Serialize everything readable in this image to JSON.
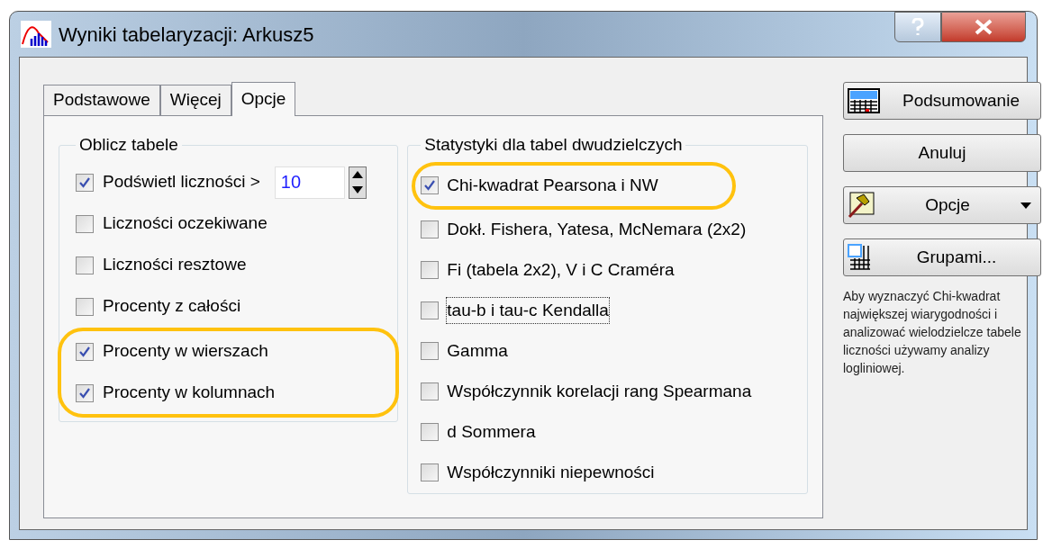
{
  "window": {
    "title": "Wyniki tabelaryzacji: Arkusz5"
  },
  "tabs": [
    {
      "label": "Podstawowe",
      "selected": false
    },
    {
      "label": "Więcej",
      "selected": false
    },
    {
      "label": "Opcje",
      "selected": true
    }
  ],
  "left_group": {
    "title": "Oblicz tabele",
    "items": [
      {
        "label": "Podświetl liczności >",
        "checked": true,
        "highlighted": false,
        "kind": "spin",
        "value": "10"
      },
      {
        "label": "Liczności oczekiwane",
        "checked": false,
        "highlighted": false,
        "kind": "check"
      },
      {
        "label": "Liczności resztowe",
        "checked": false,
        "highlighted": false,
        "kind": "check"
      },
      {
        "label": "Procenty z całości",
        "checked": false,
        "highlighted": false,
        "kind": "check"
      },
      {
        "label": "Procenty w wierszach",
        "checked": true,
        "highlighted": true,
        "kind": "check"
      },
      {
        "label": "Procenty w kolumnach",
        "checked": true,
        "highlighted": true,
        "kind": "check"
      }
    ]
  },
  "right_group": {
    "title": "Statystyki dla tabel dwudzielczych",
    "items": [
      {
        "label": "Chi-kwadrat Pearsona i NW",
        "checked": true,
        "highlighted": true,
        "focused": false
      },
      {
        "label": "Dokł. Fishera, Yatesa, McNemara (2x2)",
        "checked": false,
        "highlighted": false,
        "focused": false
      },
      {
        "label": "Fi (tabela 2x2), V i C Craméra",
        "checked": false,
        "highlighted": false,
        "focused": false
      },
      {
        "label": "tau-b i tau-c Kendalla",
        "checked": false,
        "highlighted": false,
        "focused": true
      },
      {
        "label": "Gamma",
        "checked": false,
        "highlighted": false,
        "focused": false
      },
      {
        "label": "Współczynnik korelacji rang Spearmana",
        "checked": false,
        "highlighted": false,
        "focused": false
      },
      {
        "label": "d Sommera",
        "checked": false,
        "highlighted": false,
        "focused": false
      },
      {
        "label": "Współczynniki niepewności",
        "checked": false,
        "highlighted": false,
        "focused": false
      }
    ]
  },
  "buttons": [
    {
      "label": "Podsumowanie",
      "kind": "summary"
    },
    {
      "label": "Anuluj",
      "kind": "plain"
    },
    {
      "label": "Opcje",
      "kind": "options"
    },
    {
      "label": "Grupami...",
      "kind": "groups"
    }
  ],
  "hint": "Aby wyznaczyć Chi-kwadrat największej wiarygodności i analizować wielodzielcze tabele liczności używamy analizy logliniowej."
}
